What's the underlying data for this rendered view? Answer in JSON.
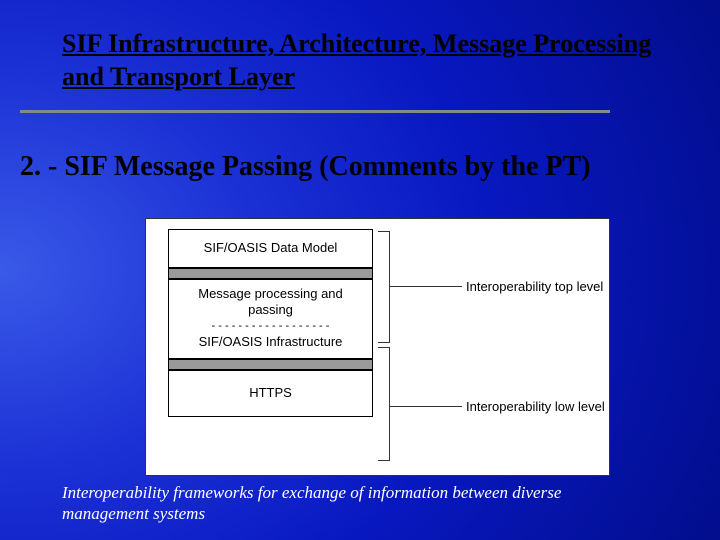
{
  "title": "SIF Infrastructure, Architecture, Message Processing and Transport Layer",
  "subtitle_prefix": "2. - ",
  "subtitle": "SIF Message Passing (Comments by the PT)",
  "diagram": {
    "layers": {
      "top": "SIF/OASIS Data Model",
      "middle_line1": "Message processing and",
      "middle_line2": "passing",
      "middle_dashes": "- - - - - - - - - - - - - - - - - -",
      "infra": "SIF/OASIS Infrastructure",
      "bottom": "HTTPS"
    },
    "labels": {
      "top": "Interoperability top level",
      "bottom": "Interoperability low level"
    }
  },
  "footer": "Interoperability frameworks for exchange of information between diverse management systems"
}
